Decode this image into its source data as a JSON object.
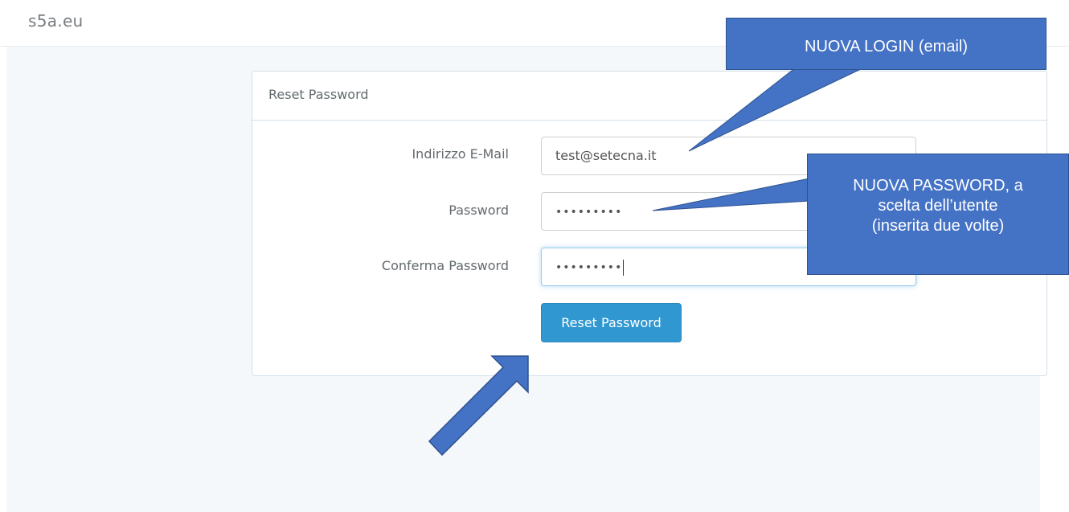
{
  "brand": "s5a.eu",
  "panel": {
    "title": "Reset Password"
  },
  "form": {
    "email": {
      "label": "Indirizzo E-Mail",
      "value": "test@setecna.it"
    },
    "password": {
      "label": "Password",
      "value": "•••••••••"
    },
    "confirm": {
      "label": "Conferma Password",
      "value": "•••••••••"
    },
    "submit_label": "Reset Password"
  },
  "annotations": {
    "login_callout": "NUOVA LOGIN (email)",
    "password_callout": [
      "NUOVA PASSWORD, a",
      "scelta dell’utente",
      "(inserita due volte)"
    ]
  },
  "colors": {
    "callout": "#4472c4",
    "button": "#3097d1",
    "background": "#f5f8fa"
  }
}
